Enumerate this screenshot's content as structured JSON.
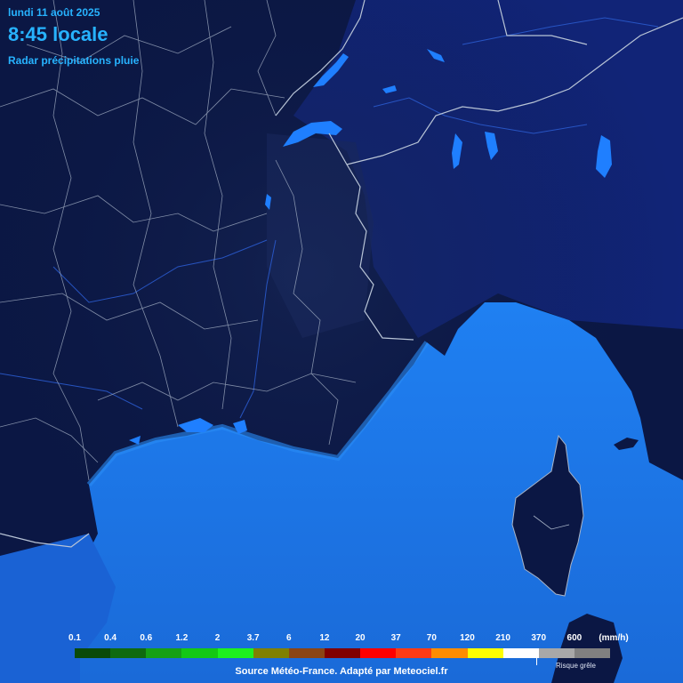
{
  "header": {
    "date": "lundi 11 août 2025",
    "time": "8:45 locale",
    "product": "Radar précipitations pluie"
  },
  "legend": {
    "unit": "(mm/h)",
    "values": [
      "0.1",
      "0.4",
      "0.6",
      "1.2",
      "2",
      "3.7",
      "6",
      "12",
      "20",
      "37",
      "70",
      "120",
      "210",
      "370",
      "600"
    ],
    "colors": [
      "#0a4a0a",
      "#0f6a0f",
      "#16a016",
      "#14c814",
      "#1ef01e",
      "#808000",
      "#8b4513",
      "#800000",
      "#ff0000",
      "#ff3b14",
      "#ff8c00",
      "#ffff00",
      "#ffffff",
      "#a8a8a8",
      "#808080"
    ],
    "hail_label": "Risque grêle"
  },
  "source": "Source Météo-France. Adapté par Meteociel.fr",
  "colors": {
    "land": "#0c1844",
    "sea_near": "#1a62d4",
    "sea_far": "#1f7ff0",
    "lake": "#1f7fff",
    "border": "#a8b4c8",
    "text_accent": "#27b3ff"
  }
}
